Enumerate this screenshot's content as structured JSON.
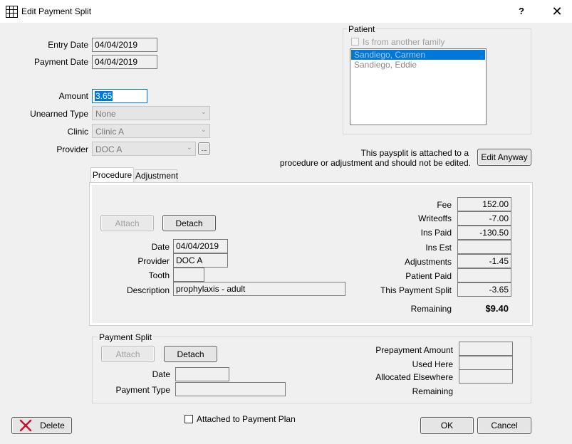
{
  "window": {
    "title": "Edit Payment Split",
    "help_label": "?",
    "close_label": "✕"
  },
  "fields": {
    "entry_date_label": "Entry Date",
    "entry_date": "04/04/2019",
    "payment_date_label": "Payment Date",
    "payment_date": "04/04/2019",
    "amount_label": "Amount",
    "amount": "3.65",
    "unearned_type_label": "Unearned Type",
    "unearned_type": "None",
    "clinic_label": "Clinic",
    "clinic": "Clinic A",
    "provider_label": "Provider",
    "provider": "DOC A",
    "provider_pick_label": "..."
  },
  "patient": {
    "title": "Patient",
    "from_other_family_label": "Is from another family",
    "list": [
      "Sandiego, Carmen",
      "Sandiego, Eddie"
    ]
  },
  "notice": {
    "line1": "This paysplit is attached to a",
    "line2": "procedure or adjustment and should not be edited.",
    "edit_anyway_label": "Edit Anyway"
  },
  "tabs": [
    "Procedure",
    "Adjustment"
  ],
  "procedure": {
    "attach_label": "Attach",
    "detach_label": "Detach",
    "date_label": "Date",
    "date": "04/04/2019",
    "provider_label": "Provider",
    "provider": "DOC A",
    "tooth_label": "Tooth",
    "tooth": "",
    "description_label": "Description",
    "description": "prophylaxis - adult",
    "fee_label": "Fee",
    "fee": "152.00",
    "writeoffs_label": "Writeoffs",
    "writeoffs": "-7.00",
    "ins_paid_label": "Ins Paid",
    "ins_paid": "-130.50",
    "ins_est_label": "Ins Est",
    "ins_est": "",
    "adjustments_label": "Adjustments",
    "adjustments": "-1.45",
    "patient_paid_label": "Patient Paid",
    "patient_paid": "",
    "this_split_label": "This Payment Split",
    "this_split": "-3.65",
    "remaining_label": "Remaining",
    "remaining": "$9.40"
  },
  "payment_split": {
    "title": "Payment Split",
    "attach_label": "Attach",
    "detach_label": "Detach",
    "date_label": "Date",
    "date": "",
    "payment_type_label": "Payment Type",
    "payment_type": "",
    "prepayment_amount_label": "Prepayment Amount",
    "prepayment_amount": "",
    "used_here_label": "Used Here",
    "used_here": "",
    "allocated_elsewhere_label": "Allocated Elsewhere",
    "allocated_elsewhere": "",
    "remaining_label": "Remaining",
    "remaining": ""
  },
  "footer": {
    "delete_label": "Delete",
    "payment_plan_label": "Attached to Payment Plan",
    "ok_label": "OK",
    "cancel_label": "Cancel"
  },
  "colors": {
    "selection": "#0078d7",
    "delete_x": "#c8102e"
  }
}
